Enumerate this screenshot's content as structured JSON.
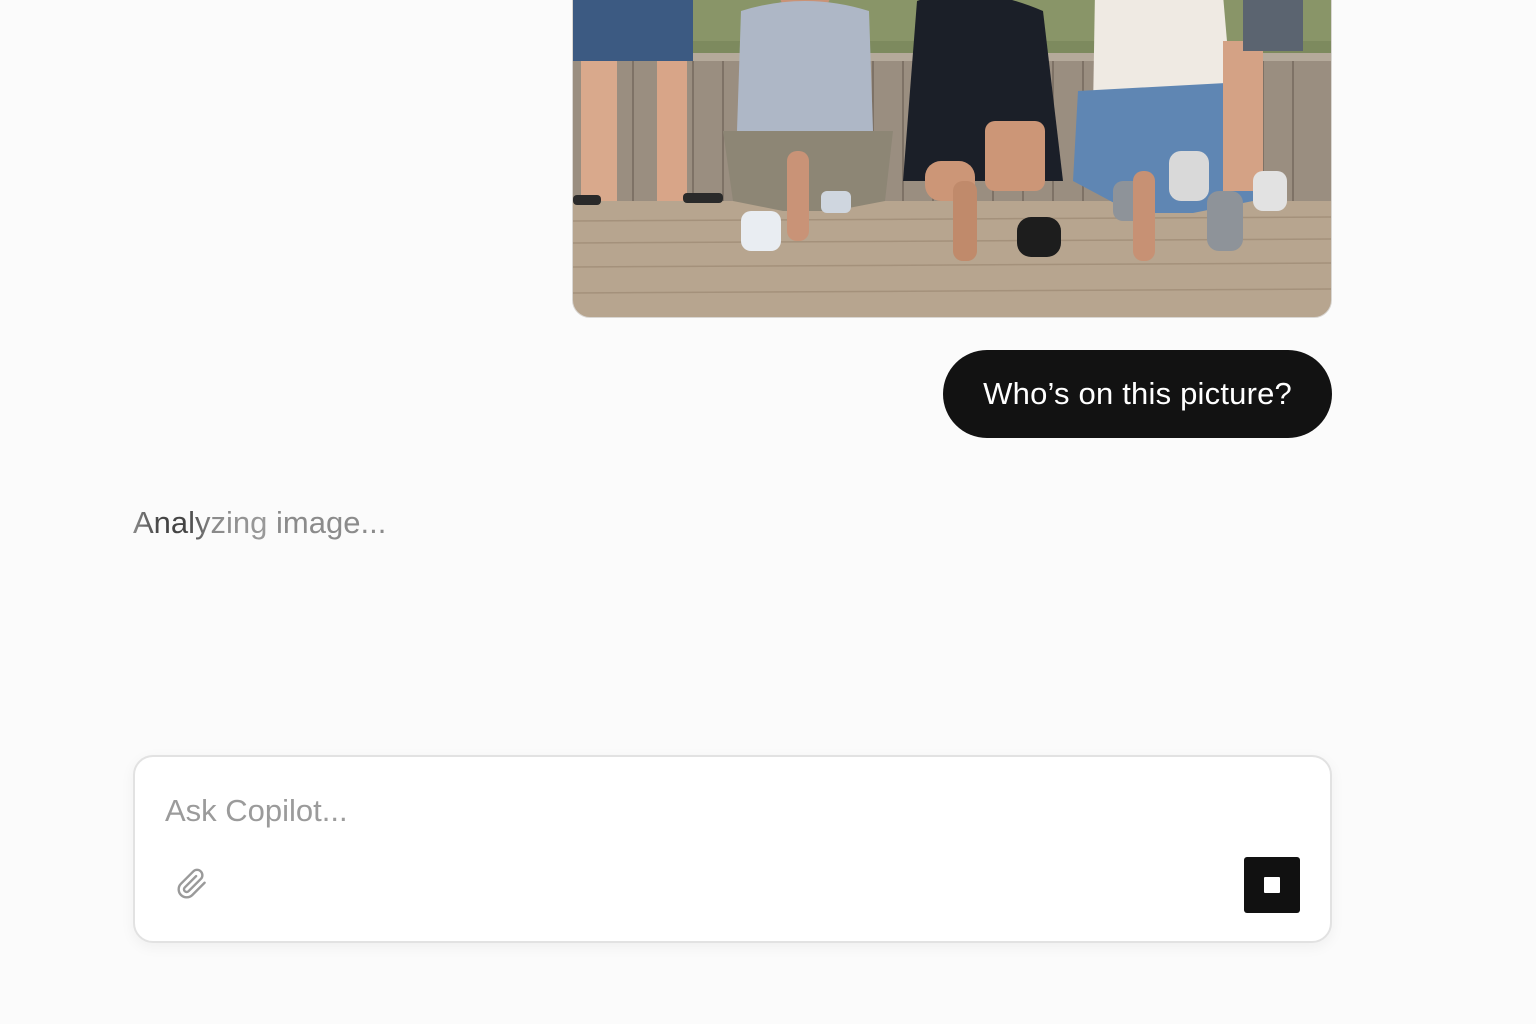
{
  "conversation": {
    "user_image": {
      "kind": "photo",
      "description_icon": "group-photo-image"
    },
    "user_message": "Who’s on this picture?",
    "assistant_status": {
      "lead": "Analyzing",
      "rest": " image..."
    }
  },
  "composer": {
    "placeholder": "Ask Copilot...",
    "value": "",
    "attach_icon": "paperclip-icon",
    "stop_icon": "stop-icon"
  },
  "colors": {
    "background": "#fbfbfb",
    "user_bubble": "#121212",
    "stop_button": "#111111",
    "status_text": "#8b8b8b"
  }
}
